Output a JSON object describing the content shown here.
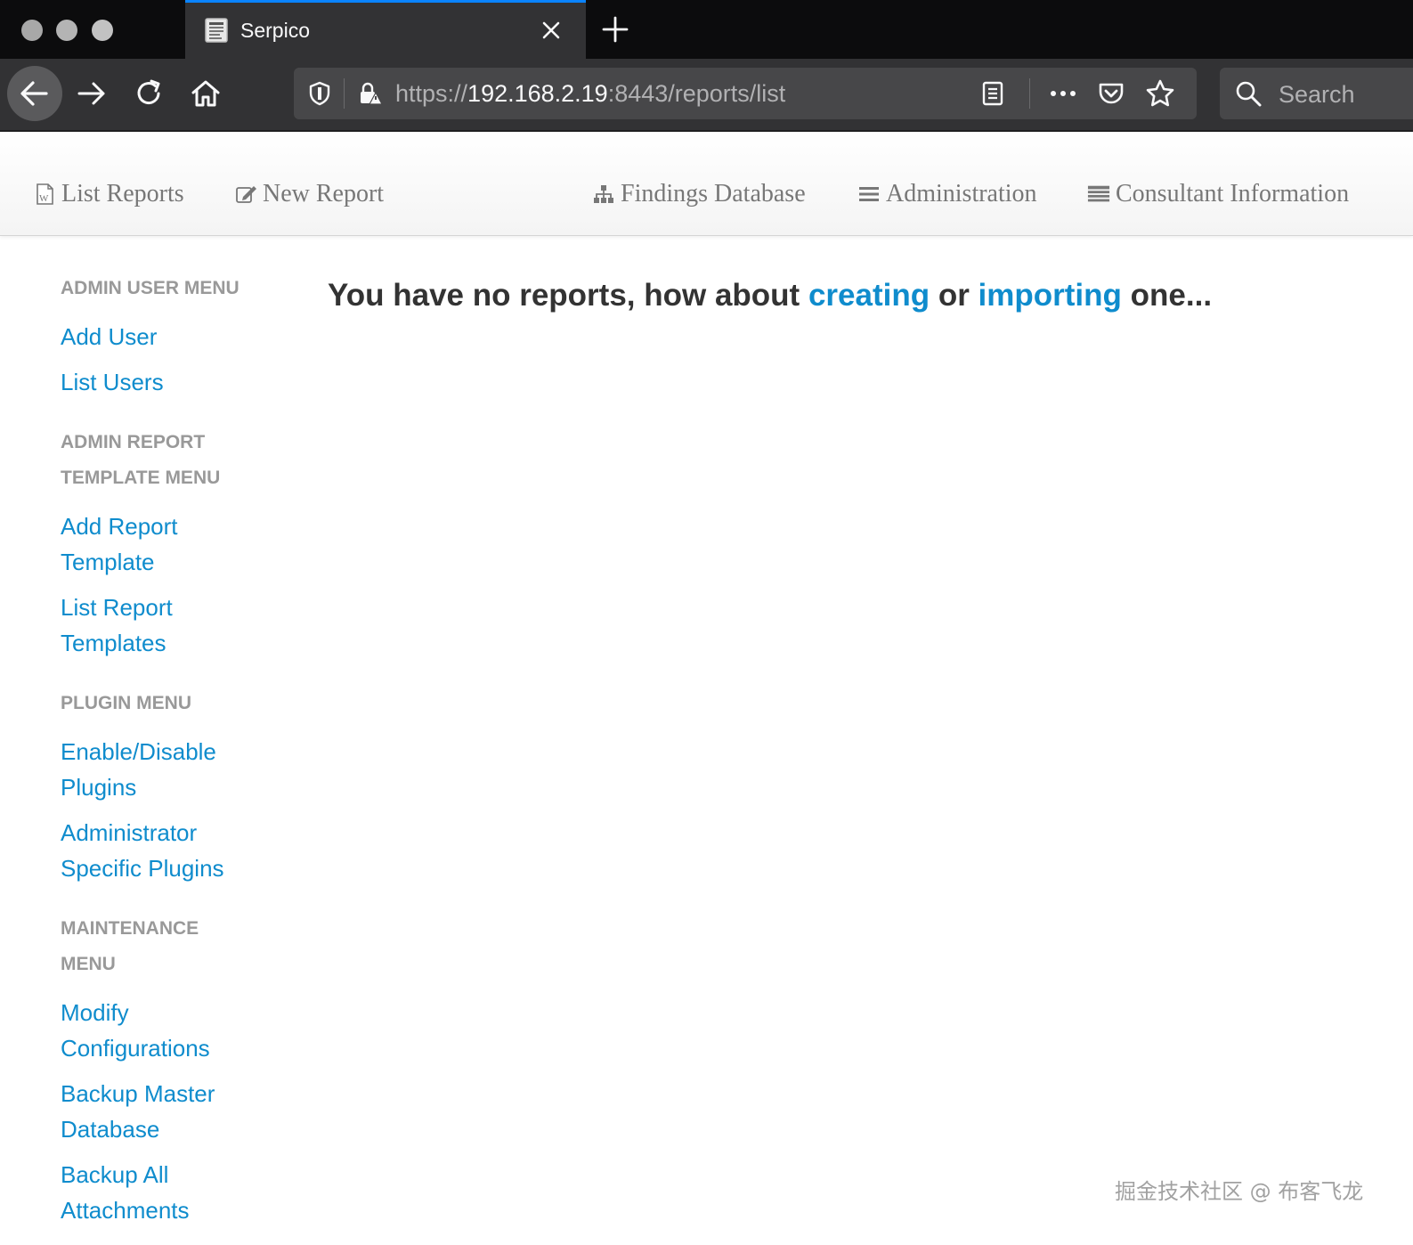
{
  "browser": {
    "tab_title": "Serpico",
    "url_scheme": "https://",
    "url_host": "192.168.2.19",
    "url_rest": ":8443/reports/list",
    "search_placeholder": "Search",
    "icons": [
      "back-icon",
      "forward-icon",
      "reload-icon",
      "home-icon",
      "shield-icon",
      "lock-icon",
      "reader-view-icon",
      "more-icon",
      "pocket-icon",
      "star-icon",
      "search-icon",
      "close-icon",
      "plus-icon"
    ],
    "accent_color": "#0a84ff"
  },
  "app_nav": {
    "items": [
      {
        "label": "List Reports",
        "icon": "word-document-icon"
      },
      {
        "label": "New Report",
        "icon": "edit-icon"
      },
      {
        "label": "Findings Database",
        "icon": "sitemap-icon"
      },
      {
        "label": "Administration",
        "icon": "list-icon"
      },
      {
        "label": "Consultant Information",
        "icon": "table-icon"
      }
    ]
  },
  "sidebar": {
    "sections": [
      {
        "header_lines": [
          "ADMIN USER MENU"
        ],
        "links": [
          [
            "Add User"
          ],
          [
            "List Users"
          ]
        ]
      },
      {
        "header_lines": [
          "ADMIN REPORT",
          "TEMPLATE MENU"
        ],
        "links": [
          [
            "Add Report",
            "Template"
          ],
          [
            "List Report",
            "Templates"
          ]
        ]
      },
      {
        "header_lines": [
          "PLUGIN MENU"
        ],
        "links": [
          [
            "Enable/Disable",
            "Plugins"
          ],
          [
            "Administrator",
            "Specific Plugins"
          ]
        ]
      },
      {
        "header_lines": [
          "MAINTENANCE",
          "MENU"
        ],
        "links": [
          [
            "Modify",
            "Configurations"
          ],
          [
            "Backup Master",
            "Database"
          ],
          [
            "Backup All",
            "Attachments"
          ]
        ]
      }
    ]
  },
  "main": {
    "msg_before": "You have no reports, how about ",
    "link_creating": "creating",
    "msg_middle": " or ",
    "link_importing": "importing",
    "msg_after": " one..."
  },
  "colors": {
    "link": "#0f8ccd",
    "header_gray": "#999999",
    "heading_text": "#333333"
  },
  "watermark": "掘金技术社区 @ 布客飞龙"
}
